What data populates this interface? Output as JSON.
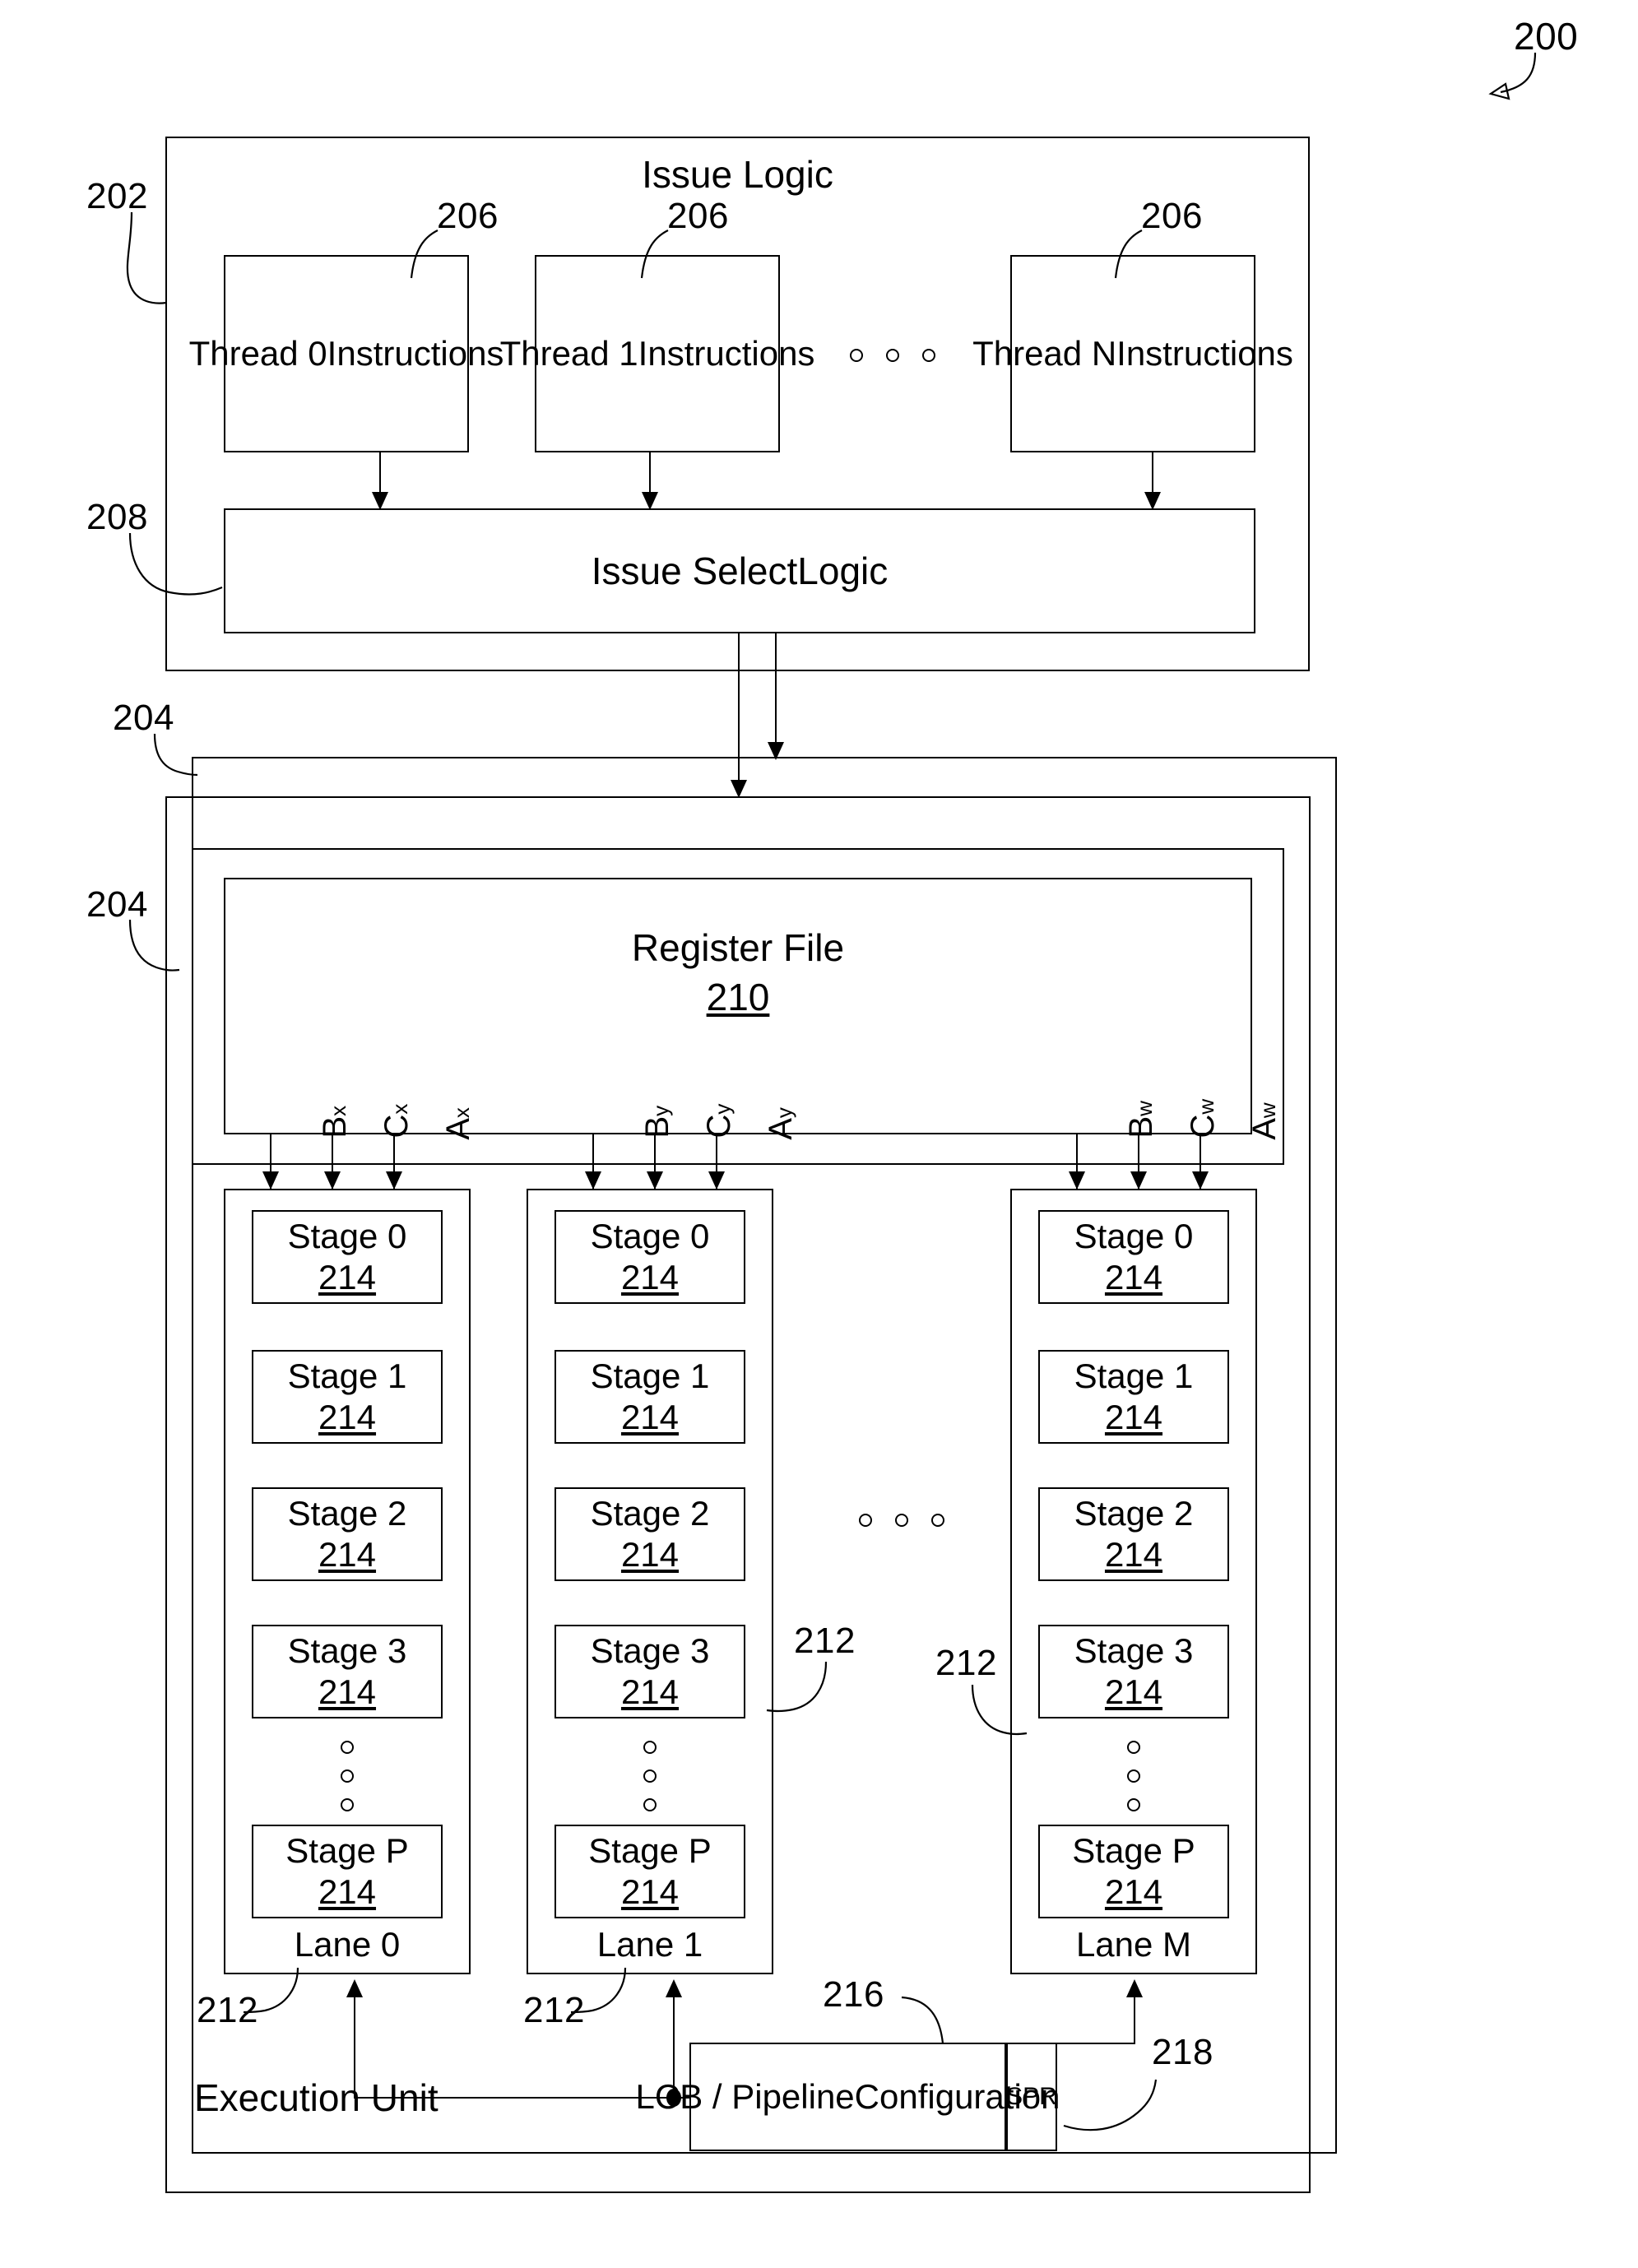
{
  "figure": {
    "number": "200",
    "issue_logic": {
      "title": "Issue Logic",
      "ref": "202",
      "threads": [
        {
          "label": "Thread 0\nInstructions",
          "ref": "206"
        },
        {
          "label": "Thread 1\nInstructions",
          "ref": "206"
        },
        {
          "label": "Thread N\nInstructions",
          "ref": "206"
        }
      ],
      "thread_ellipsis": "○ ○ ○",
      "issue_select": {
        "label": "Issue Select\nLogic",
        "ref": "208"
      }
    },
    "execution_unit": {
      "title": "Execution Unit",
      "ref": "204",
      "ref_outer": "204",
      "register_file": {
        "label": "Register File",
        "ref": "210"
      },
      "buses": [
        {
          "name": "B",
          "sub": "x"
        },
        {
          "name": "C",
          "sub": "x"
        },
        {
          "name": "A",
          "sub": "x"
        },
        {
          "name": "B",
          "sub": "y"
        },
        {
          "name": "C",
          "sub": "y"
        },
        {
          "name": "A",
          "sub": "y"
        },
        {
          "name": "B",
          "sub": "w"
        },
        {
          "name": "C",
          "sub": "w"
        },
        {
          "name": "A",
          "sub": "w"
        }
      ],
      "lanes": [
        {
          "name": "Lane 0",
          "ref": "212"
        },
        {
          "name": "Lane 1",
          "ref": "212"
        },
        {
          "name": "Lane M",
          "ref": "212"
        }
      ],
      "lane_ref_mid": "212",
      "lane_ellipsis": "○ ○ ○",
      "stages": [
        {
          "label": "Stage 0",
          "ref": "214"
        },
        {
          "label": "Stage 1",
          "ref": "214"
        },
        {
          "label": "Stage 2",
          "ref": "214"
        },
        {
          "label": "Stage 3",
          "ref": "214"
        },
        {
          "label": "Stage P",
          "ref": "214"
        }
      ],
      "lcb": {
        "label": "LCB / Pipeline\nConfiguration",
        "ref": "216"
      },
      "spr": {
        "label": "S\nP\nR",
        "ref": "218"
      }
    }
  }
}
